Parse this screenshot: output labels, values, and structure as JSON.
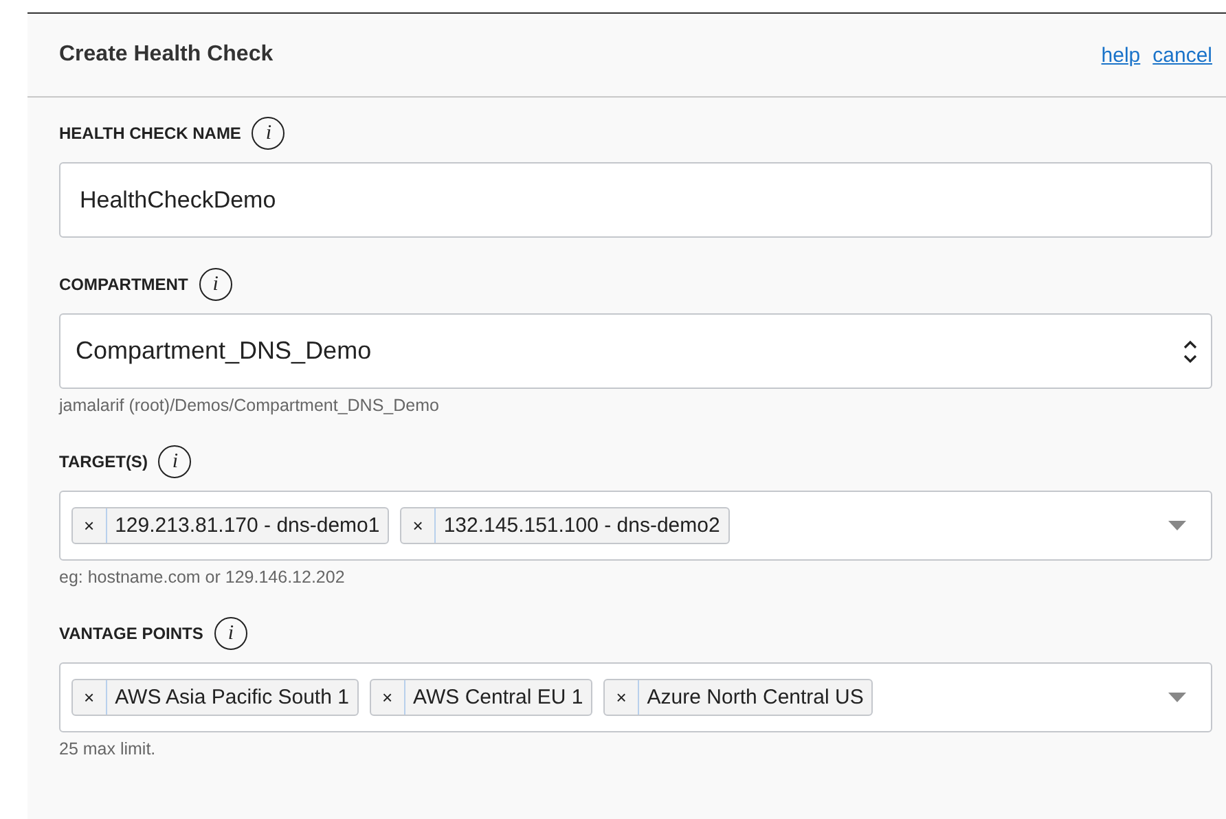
{
  "header": {
    "title": "Create Health Check",
    "links": [
      "help",
      "cancel"
    ]
  },
  "fields": [
    {
      "kind": "text",
      "label": "HEALTH CHECK NAME",
      "info": "i",
      "value": "HealthCheckDemo"
    },
    {
      "kind": "select",
      "label": "COMPARTMENT",
      "info": "i",
      "value": "Compartment_DNS_Demo",
      "hint": "jamalarif (root)/Demos/Compartment_DNS_Demo"
    },
    {
      "kind": "tags",
      "label": "TARGET(S)",
      "info": "i",
      "remove": "×",
      "tags": [
        "129.213.81.170 - dns-demo1",
        "132.145.151.100 - dns-demo2"
      ],
      "hint": "eg: hostname.com or 129.146.12.202"
    },
    {
      "kind": "tags",
      "label": "VANTAGE POINTS",
      "info": "i",
      "remove": "×",
      "tags": [
        "AWS Asia Pacific South 1",
        "AWS Central EU 1",
        "Azure North Central US"
      ],
      "hint": "25 max limit."
    }
  ]
}
